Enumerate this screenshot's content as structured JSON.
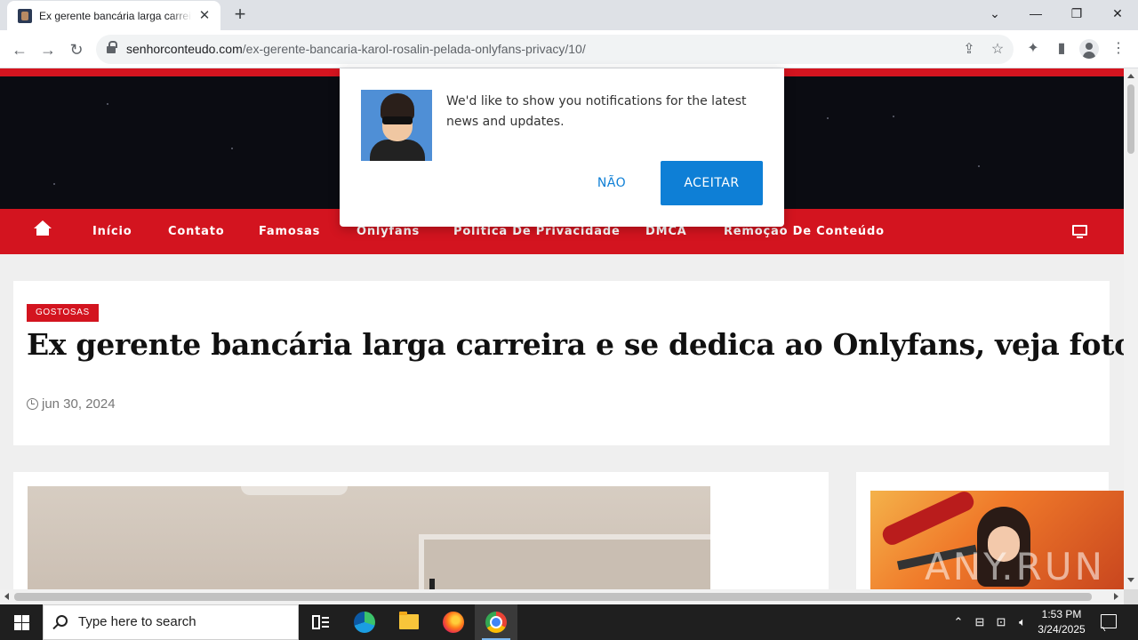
{
  "browser": {
    "tab_title": "Ex gerente bancária larga carreira e se dedica ao Onlyfans, veja fotos",
    "url_domain": "senhorconteudo.com",
    "url_path": "/ex-gerente-bancaria-karol-rosalin-pelada-onlyfans-privacy/10/",
    "new_tab_symbol": "+",
    "close_tab_symbol": "✕"
  },
  "site": {
    "nav_items": [
      "Início",
      "Contato",
      "Famosas",
      "Onlyfans",
      "Política De Privacidade",
      "DMCA",
      "Remoção De Conteúdo"
    ],
    "category": "GOSTOSAS",
    "post_title": "Ex gerente bancária larga carreira e se dedica ao Onlyfans, veja fotos",
    "post_date": "jun 30, 2024",
    "watermark": "ANY.RUN"
  },
  "notification": {
    "message": "We'd like to show you notifications for the latest news and updates.",
    "decline_label": "NÃO",
    "accept_label": "ACEITAR"
  },
  "taskbar": {
    "search_placeholder": "Type here to search",
    "time": "1:53 PM",
    "date": "3/24/2025"
  },
  "colors": {
    "brand_red": "#d3141f",
    "accept_blue": "#0e7fd6"
  }
}
